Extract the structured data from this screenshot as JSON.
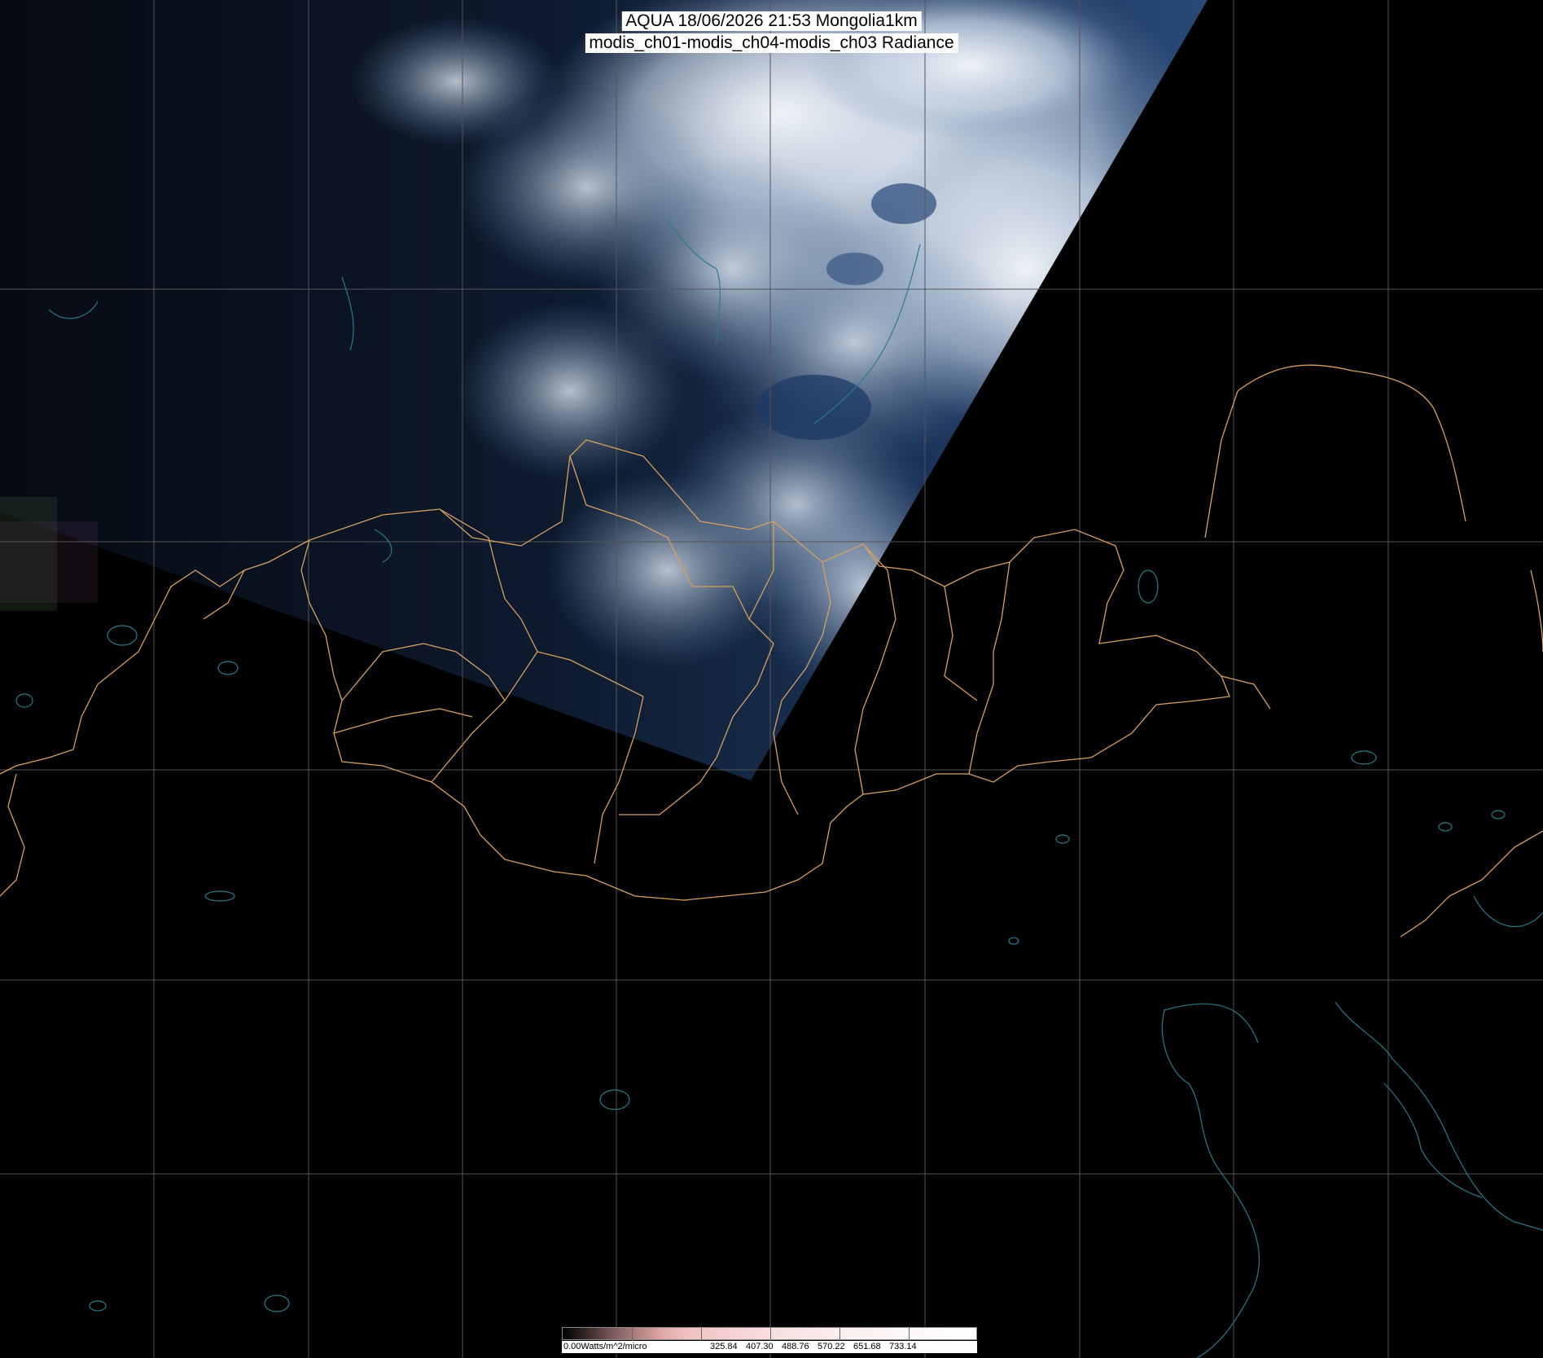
{
  "title": {
    "line1": "AQUA 18/06/2026 21:53 Mongolia1km",
    "line2": "modis_ch01-modis_ch04-modis_ch03 Radiance"
  },
  "colorbar": {
    "unit_label": "0.00Watts/m^2/micro",
    "tick_labels": [
      "325.84",
      "407.30",
      "488.76",
      "570.22",
      "651.68",
      "733.14"
    ]
  },
  "colors": {
    "background": "#000000",
    "grid": "#555555",
    "admin_border": "#d8a060",
    "coastline": "#2a7a8a",
    "cloud": "#e8eef5",
    "land_day": "#0e1a2c"
  }
}
